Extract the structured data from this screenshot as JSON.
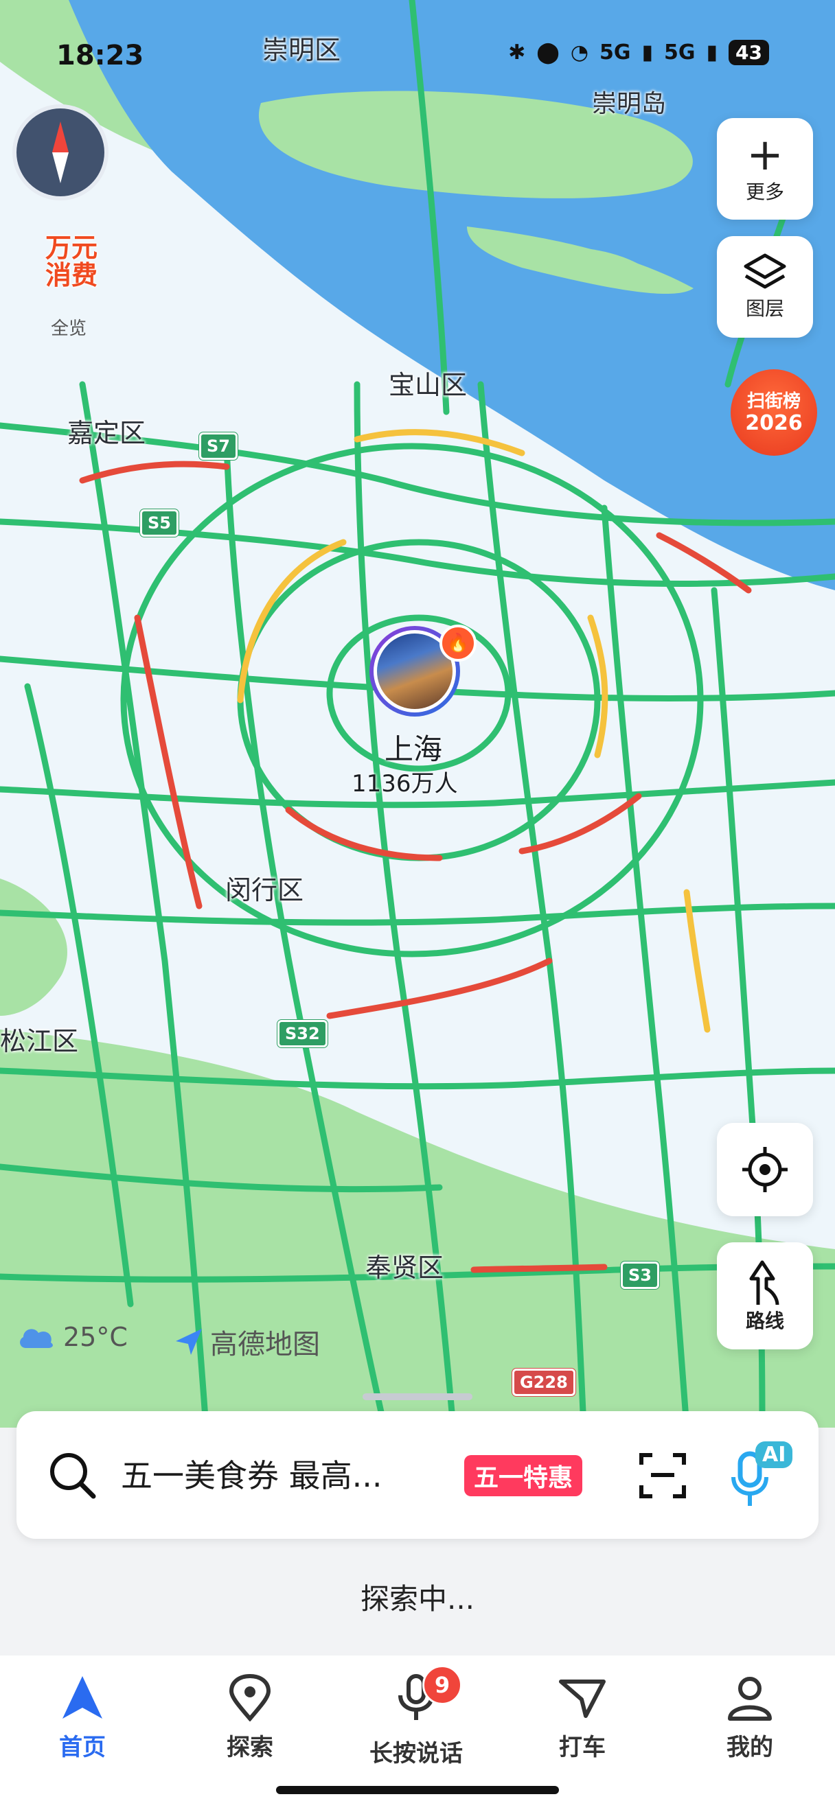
{
  "status_bar": {
    "time": "18:23",
    "signal1": "5G",
    "signal2": "5G",
    "battery": "43"
  },
  "map": {
    "district_labels": [
      "崇明区",
      "崇明岛",
      "宝山区",
      "嘉定区",
      "闵行区",
      "松江区",
      "奉贤区"
    ],
    "road_shields": [
      "S7",
      "S5",
      "S32",
      "S3",
      "G228"
    ],
    "city": {
      "name": "上海",
      "population": "1136万人"
    }
  },
  "controls": {
    "promo_top": "万元",
    "promo_bottom": "消费",
    "promo_caption": "全览",
    "more_label": "更多",
    "layers_label": "图层",
    "ranking_line1": "扫街榜",
    "ranking_line2": "2026",
    "route_label": "路线"
  },
  "weather": {
    "temp": "25°C",
    "icon": "cloud-icon"
  },
  "brand": "高德地图",
  "search": {
    "query": "五一美食券 最高...",
    "promo_tag": "五一特惠",
    "ai_label": "AI"
  },
  "explore_status": "探索中...",
  "tabs": [
    {
      "label": "首页",
      "icon": "navigation-arrow-icon",
      "active": true
    },
    {
      "label": "探索",
      "icon": "location-pin-icon"
    },
    {
      "label": "长按说话",
      "icon": "microphone-icon",
      "badge": "9"
    },
    {
      "label": "打车",
      "icon": "taxi-icon"
    },
    {
      "label": "我的",
      "icon": "profile-icon"
    }
  ],
  "colors": {
    "accent": "#2a6bf0",
    "traffic_free": "#2fbf71",
    "traffic_slow": "#f5c23d",
    "traffic_jam": "#e54a3a",
    "water": "#58a8e8",
    "land": "#a8e2a5"
  }
}
